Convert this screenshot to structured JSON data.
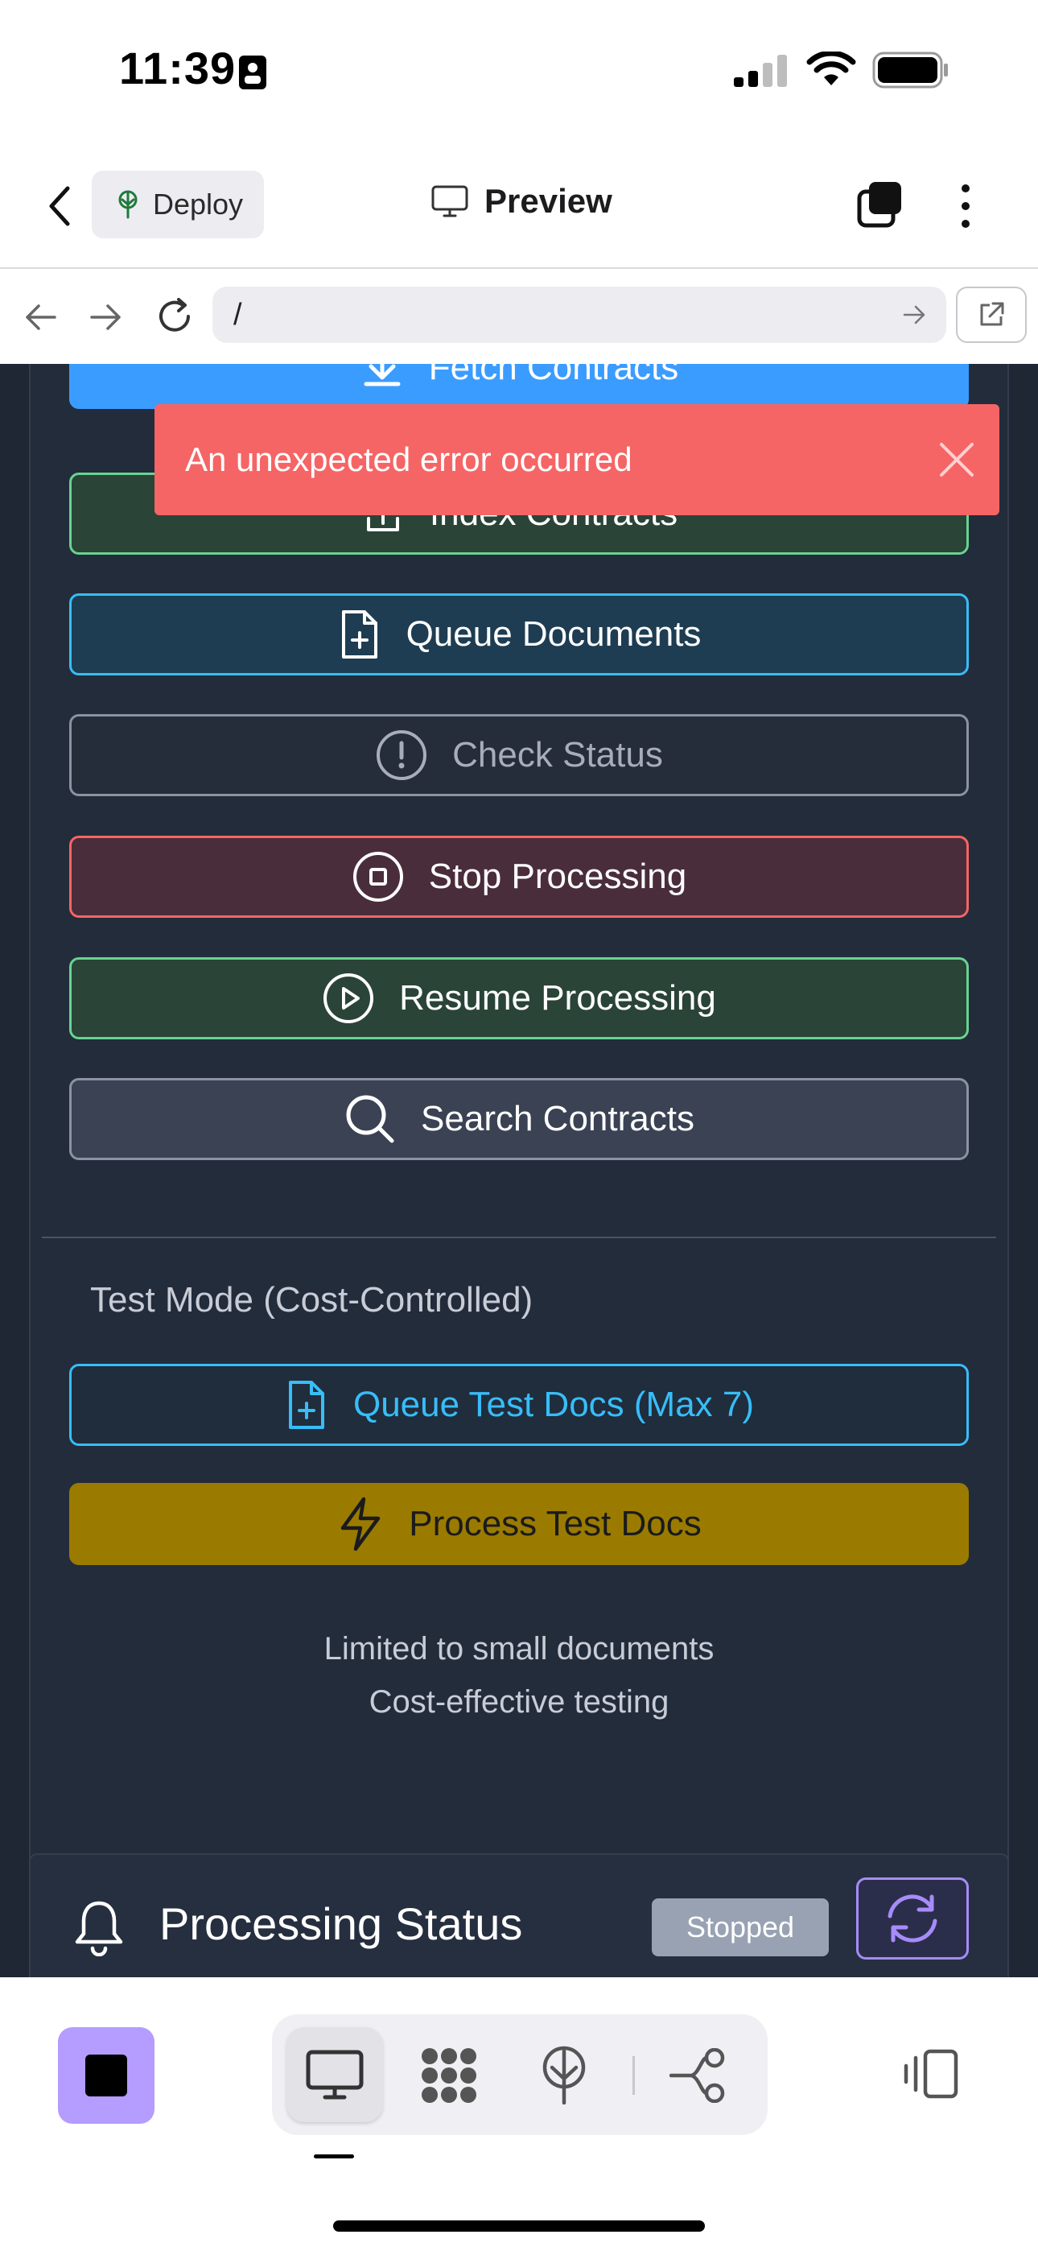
{
  "status_bar": {
    "time": "11:39"
  },
  "header": {
    "deploy_label": "Deploy",
    "title": "Preview"
  },
  "browser": {
    "url": "/"
  },
  "toast": {
    "message": "An unexpected error occurred"
  },
  "actions": [
    {
      "label": "Fetch Contracts",
      "icon": "download-icon"
    },
    {
      "label": "Index Contracts",
      "icon": "upload-icon"
    },
    {
      "label": "Queue Documents",
      "icon": "file-plus-icon"
    },
    {
      "label": "Check Status",
      "icon": "alert-circle-icon"
    },
    {
      "label": "Stop Processing",
      "icon": "stop-circle-icon"
    },
    {
      "label": "Resume Processing",
      "icon": "play-circle-icon"
    },
    {
      "label": "Search Contracts",
      "icon": "search-icon"
    }
  ],
  "test_mode": {
    "label": "Test Mode (Cost-Controlled)",
    "queue_label": "Queue Test Docs (Max 7)",
    "process_label": "Process Test Docs",
    "notes": [
      "Limited to small documents",
      "Cost-effective testing"
    ]
  },
  "processing_status": {
    "title": "Processing Status",
    "badge": "Stopped"
  },
  "colors": {
    "blue": "#3b9cff",
    "green": "#68d391",
    "cyan": "#38bdf8",
    "red": "#f56565",
    "gold": "#9a7b00",
    "purple": "#a78bfa",
    "slate": "#98a2b3"
  }
}
